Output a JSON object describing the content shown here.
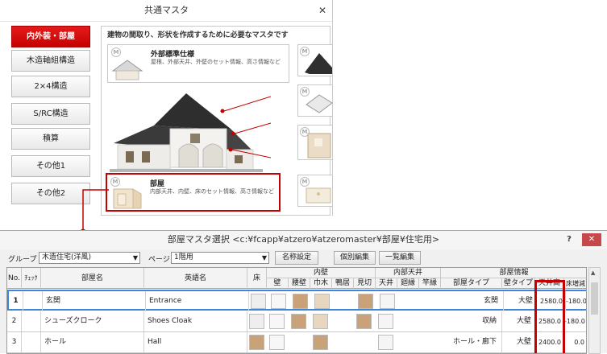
{
  "window1": {
    "title": "共通マスタ",
    "close": "✕",
    "categories": [
      "内外装・部屋",
      "木造軸組構造",
      "2×4構造",
      "S/RC構造",
      "積算",
      "その他1",
      "その他2"
    ],
    "active_category": "内外装・部屋",
    "description": "建物の間取り、形状を作成するために必要なマスタです",
    "cards": [
      {
        "title": "外部標準仕様",
        "desc": "屋根、外部天井、外壁のセット情報、高さ情報など"
      },
      {
        "title": "部屋",
        "desc": "内部天井、内壁、床のセット情報、高さ情報など"
      }
    ],
    "m_badge": "M"
  },
  "window2": {
    "title": "部屋マスタ選択 <c:¥fcapp¥atzero¥atzeromaster¥部屋¥住宅用>",
    "help": "?",
    "close": "✕",
    "toolbar": {
      "group_label": "グループ",
      "group_value": "木造住宅(洋風)",
      "page_label": "ページ",
      "page_value": "1階用",
      "btn_name_setting": "名称設定",
      "btn_individual_edit": "個別編集",
      "btn_list_edit": "一覧編集"
    },
    "headers": {
      "no": "No.",
      "check": "ﾁｪｯｸ",
      "room_name": "部屋名",
      "english_name": "英語名",
      "floor": "床",
      "inner_wall_group": "内壁",
      "wall": "壁",
      "waist_wall": "腰壁",
      "skirting": "巾木",
      "kamoi": "鴨居",
      "mikiri": "見切",
      "inner_ceiling_group": "内部天井",
      "ceiling": "天井",
      "mawaribuchi": "廻縁",
      "sasaobuchi": "竿縁",
      "room_info_group": "部屋情報",
      "room_type": "部屋タイプ",
      "wall_type": "壁タイプ",
      "ceiling_height": "天井高",
      "floor_adjust": "床増減"
    },
    "rows": [
      {
        "no": "1",
        "name": "玄関",
        "english": "Entrance",
        "room_type": "玄関",
        "wall_type": "大壁",
        "ceiling_height": "2580.0",
        "floor_adjust": "-180.0"
      },
      {
        "no": "2",
        "name": "シューズクローク",
        "english": "Shoes Cloak",
        "room_type": "収納",
        "wall_type": "大壁",
        "ceiling_height": "2580.0",
        "floor_adjust": "-180.0"
      },
      {
        "no": "3",
        "name": "ホール",
        "english": "Hall",
        "room_type": "ホール・廊下",
        "wall_type": "大壁",
        "ceiling_height": "2400.0",
        "floor_adjust": "0.0"
      }
    ]
  },
  "colors": {
    "accent_red": "#c40000",
    "selection_blue": "#3d86d8",
    "wood": "#c9a27a",
    "beige": "#e8d7c0"
  }
}
